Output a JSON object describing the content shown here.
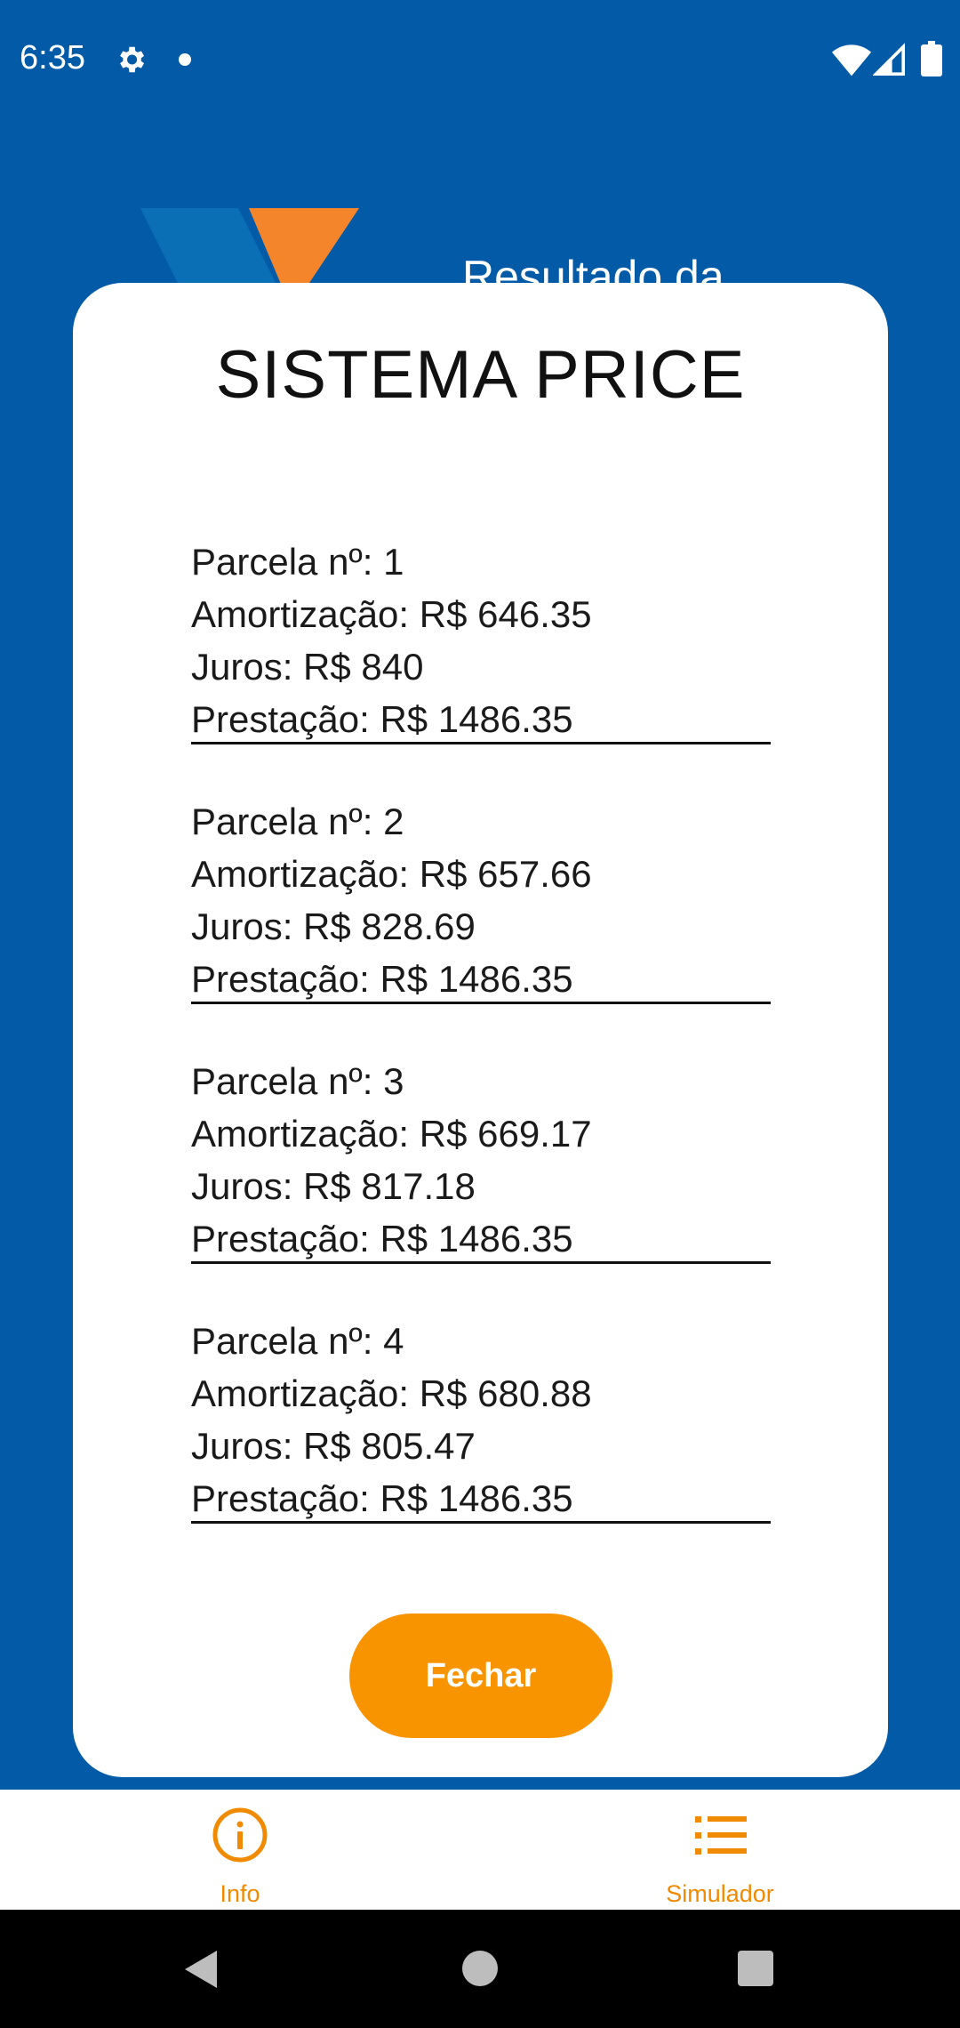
{
  "status_bar": {
    "time": "6:35",
    "icons": [
      "gear-icon",
      "dot-icon",
      "wifi-icon",
      "signal-icon",
      "battery-icon"
    ]
  },
  "background": {
    "title": "Resultado da",
    "logo_colors": {
      "blue": "#0A6FB5",
      "orange": "#F5852A"
    }
  },
  "modal": {
    "title": "SISTEMA PRICE",
    "installments": [
      {
        "parcela": "Parcela nº: 1",
        "amortizacao": "Amortização: R$ 646.35",
        "juros": "Juros: R$ 840",
        "prestacao": "Prestação: R$ 1486.35"
      },
      {
        "parcela": "Parcela nº: 2",
        "amortizacao": "Amortização: R$ 657.66",
        "juros": "Juros: R$ 828.69",
        "prestacao": "Prestação: R$ 1486.35"
      },
      {
        "parcela": "Parcela nº: 3",
        "amortizacao": "Amortização: R$ 669.17",
        "juros": "Juros: R$ 817.18",
        "prestacao": "Prestação: R$ 1486.35"
      },
      {
        "parcela": "Parcela nº: 4",
        "amortizacao": "Amortização: R$ 680.88",
        "juros": "Juros: R$ 805.47",
        "prestacao": "Prestação: R$ 1486.35"
      }
    ],
    "close_label": "Fechar"
  },
  "bottom_nav": {
    "items": [
      {
        "label": "Info",
        "icon": "info-icon"
      },
      {
        "label": "Simulador",
        "icon": "list-icon"
      }
    ]
  },
  "colors": {
    "background": "#035BA8",
    "accent": "#F89400",
    "nav_active": "#F08A00"
  }
}
